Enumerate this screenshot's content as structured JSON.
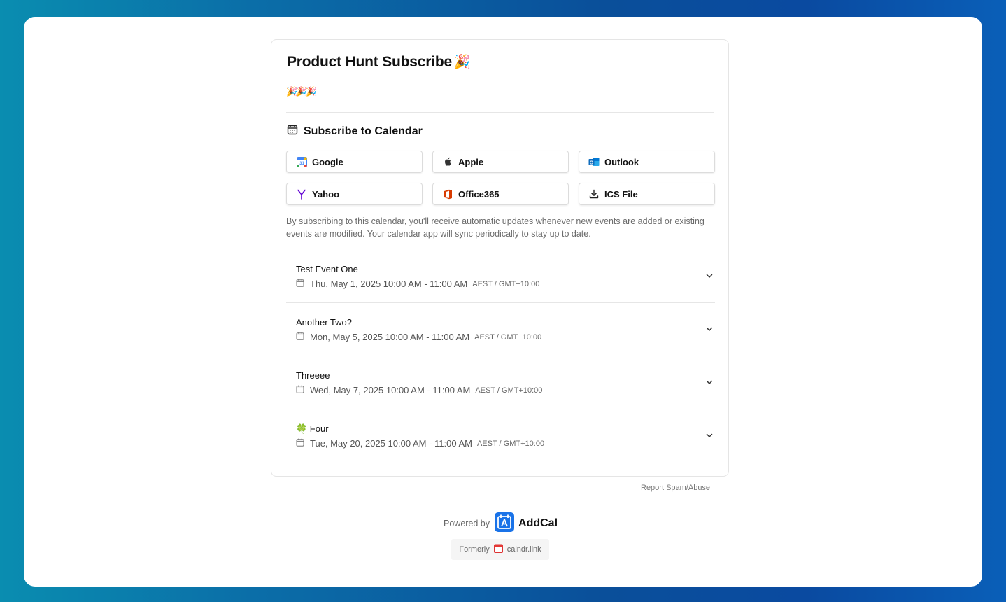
{
  "page": {
    "title": "Product Hunt Subscribe",
    "title_emoji": "🎉",
    "description": "🎉🎉🎉"
  },
  "subscribe": {
    "heading": "Subscribe to Calendar",
    "buttons": [
      {
        "label": "Google",
        "icon": "google-calendar-icon"
      },
      {
        "label": "Apple",
        "icon": "apple-icon"
      },
      {
        "label": "Outlook",
        "icon": "outlook-icon"
      },
      {
        "label": "Yahoo",
        "icon": "yahoo-icon"
      },
      {
        "label": "Office365",
        "icon": "office365-icon"
      },
      {
        "label": "ICS File",
        "icon": "download-icon"
      }
    ],
    "note": "By subscribing to this calendar, you'll receive automatic updates whenever new events are added or existing events are modified. Your calendar app will sync periodically to stay up to date."
  },
  "events": [
    {
      "title": "Test Event One",
      "date": "Thu, May 1, 2025 10:00 AM - 11:00 AM",
      "tz": "AEST / GMT+10:00"
    },
    {
      "title": "Another Two?",
      "date": "Mon, May 5, 2025 10:00 AM - 11:00 AM",
      "tz": "AEST / GMT+10:00"
    },
    {
      "title": "Threeee",
      "date": "Wed, May 7, 2025 10:00 AM - 11:00 AM",
      "tz": "AEST / GMT+10:00"
    },
    {
      "title": "🍀 Four",
      "date": "Tue, May 20, 2025 10:00 AM - 11:00 AM",
      "tz": "AEST / GMT+10:00"
    }
  ],
  "footer": {
    "report": "Report Spam/Abuse",
    "powered_by": "Powered by",
    "brand": "AddCal",
    "formerly": "Formerly",
    "former_name": "calndr.link"
  },
  "colors": {
    "brand_blue": "#1a73e8",
    "google_blue": "#4285f4",
    "outlook_blue": "#0f6cbd",
    "yahoo_purple": "#6001d2",
    "office_red": "#d83b01"
  }
}
